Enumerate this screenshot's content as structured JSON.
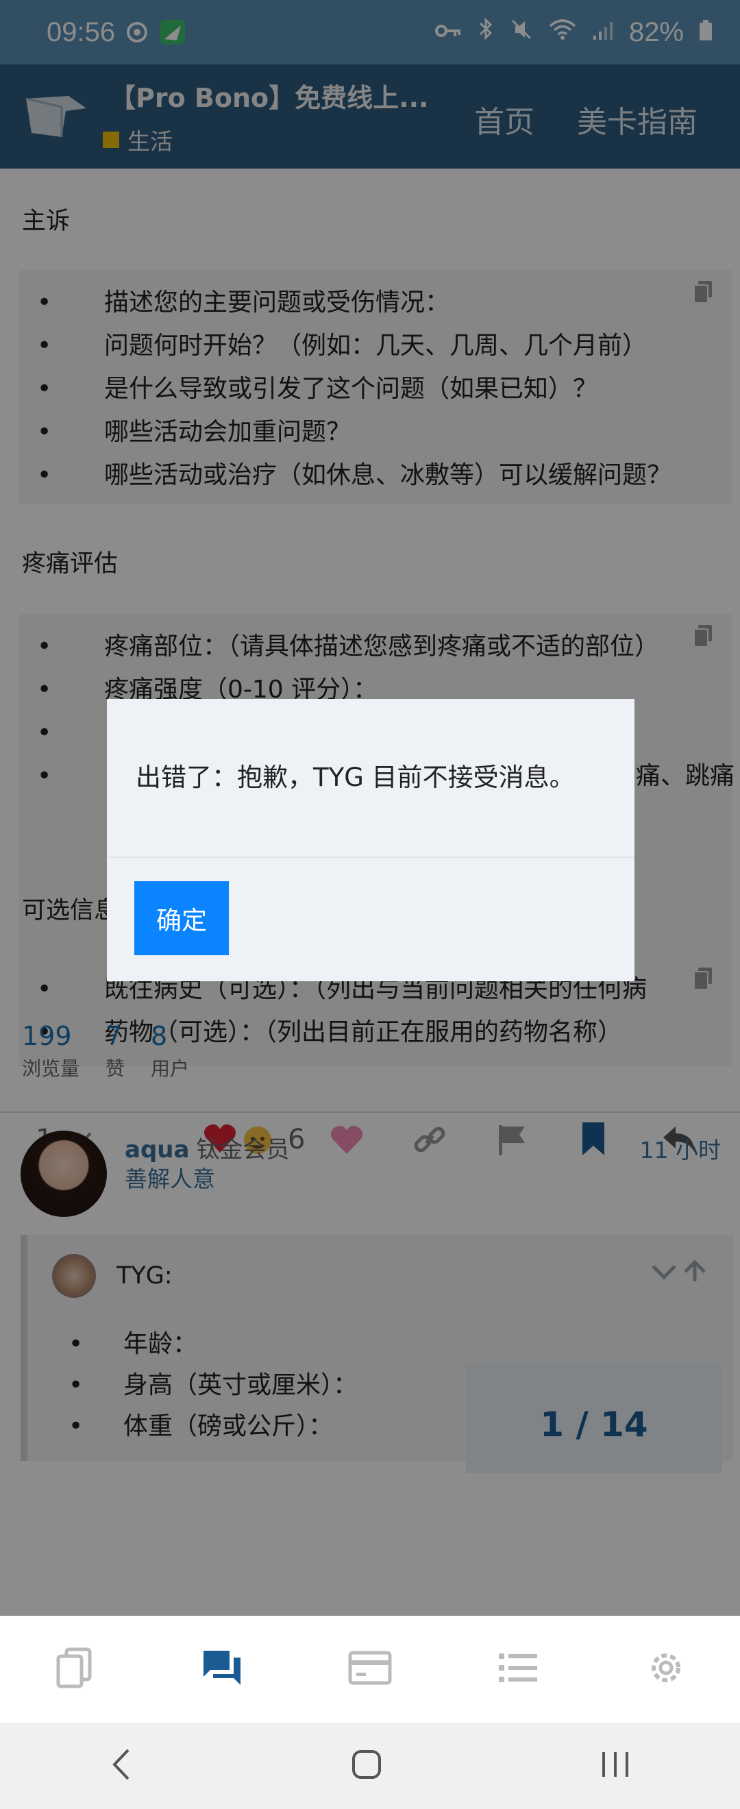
{
  "statusbar": {
    "time": "09:56",
    "battery": "82%"
  },
  "header": {
    "title": "【Pro Bono】免费线上...",
    "category": "生活",
    "nav": [
      "首页",
      "美卡指南"
    ]
  },
  "sections": {
    "complaint": {
      "title": "主诉",
      "items": [
        "描述您的主要问题或受伤情况：",
        "问题何时开始？（例如：几天、几周、几个月前）",
        "是什么导致或引发了这个问题（如果已知）？",
        "哪些活动会加重问题？",
        "哪些活动或治疗（如休息、冰敷等）可以缓解问题？"
      ]
    },
    "pain": {
      "title": "疼痛评估",
      "items": [
        "疼痛部位：（请具体描述您感到疼痛或不适的部位）",
        "疼痛强度（0-10 评分）：",
        "",
        "）",
        "痛、跳痛"
      ]
    },
    "optional": {
      "title": "可选信息",
      "items": [
        "既往病史（可选）：（列出与当前问题相关的任何病",
        "药物（可选）：（列出目前正在服用的药物名称）"
      ]
    }
  },
  "actions": {
    "reply_count": "1",
    "likes": "6"
  },
  "stats": [
    {
      "num": "199",
      "label": "浏览量"
    },
    {
      "num": "7",
      "label": "赞"
    },
    {
      "num": "8",
      "label": "用户"
    }
  ],
  "post": {
    "username": "aqua",
    "group": "钛金会员",
    "user_title": "善解人意",
    "time": "11 小时",
    "quote": {
      "name": "TYG:",
      "items": [
        "年龄：",
        "身高（英寸或厘米）：",
        "体重（磅或公斤）："
      ]
    }
  },
  "progress": "1 / 14",
  "dialog": {
    "message": "出错了：抱歉，TYG 目前不接受消息。",
    "ok": "确定"
  },
  "colors": {
    "header": "#2f5c7f",
    "statusbar": "#5a8fb5",
    "accent": "#0a84ff",
    "link": "#1a6fb0"
  },
  "icons": [
    "copy-icon",
    "heart-icon",
    "link-icon",
    "flag-icon",
    "bookmark-icon",
    "reply-icon",
    "chevron-down-icon",
    "chevron-up-icon",
    "topics-icon",
    "chat-icon",
    "card-icon",
    "list-icon",
    "settings-icon",
    "back-icon",
    "home-icon",
    "recents-icon"
  ]
}
